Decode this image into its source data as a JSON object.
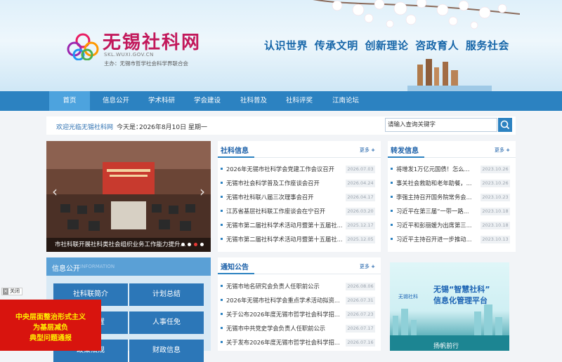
{
  "header": {
    "logo_title": "无锡社科网",
    "logo_url": "SKL.WUXI.GOV.CN",
    "logo_sub": "主办：无锡市哲学社会科学界联合会",
    "slogan": "认识世界 传承文明 创新理论 咨政育人 服务社会"
  },
  "nav": [
    "首页",
    "信息公开",
    "学术科研",
    "学会建设",
    "社科普及",
    "社科评奖",
    "江南论坛"
  ],
  "infobar": {
    "welcome": "欢迎光临无锡社科网",
    "today_label": "今天是：",
    "date": "2026年8月10日 星期一",
    "search_placeholder": "请输入查询关键字"
  },
  "slide": {
    "caption": "市社科联开展社科类社会组织业务工作能力提升..."
  },
  "sk_news": {
    "title": "社科信息",
    "more": "更多",
    "items": [
      {
        "title": "2026年无锡市社科学会党建工作会议召开",
        "date": "2026.07.03"
      },
      {
        "title": "无锡市社会科学普及工作座谈会召开",
        "date": "2026.04.24"
      },
      {
        "title": "无锡市社科联八届三次理事会召开",
        "date": "2026.04.17"
      },
      {
        "title": "江苏省基层社科联工作座谈会在宁召开",
        "date": "2026.03.20"
      },
      {
        "title": "无锡市第二届社科学术活动月暨第十五届社...",
        "date": "2025.12.17"
      },
      {
        "title": "无锡市第二届社科学术活动月暨第十五届社...",
        "date": "2025.12.05"
      }
    ]
  },
  "zf_news": {
    "title": "转发信息",
    "more": "更多",
    "items": [
      {
        "title": "将增发1万亿元国债！怎么...",
        "date": "2023.10.26"
      },
      {
        "title": "事关社会救助和老年助餐，...",
        "date": "2023.10.26"
      },
      {
        "title": "李强主持召开国务院常务会...",
        "date": "2023.10.23"
      },
      {
        "title": "习近平在第三届“一带一路...",
        "date": "2023.10.18"
      },
      {
        "title": "习近平和彭丽媛为出席第三...",
        "date": "2023.10.18"
      },
      {
        "title": "习近平主持召开进一步推动...",
        "date": "2023.10.13"
      }
    ]
  },
  "notice": {
    "title": "通知公告",
    "more": "更多",
    "items": [
      {
        "title": "无锡市地名研究会负责人任职前公示",
        "date": "2026.08.06"
      },
      {
        "title": "2026年无锡市社科学会重点学术活动拟资...",
        "date": "2026.07.31"
      },
      {
        "title": "关于公布2026年度无锡市哲学社会科学招...",
        "date": "2026.07.23"
      },
      {
        "title": "无锡市中共党史学会负责人任职前公示",
        "date": "2026.07.17"
      },
      {
        "title": "关于发布2026年度无锡市哲学社会科学招...",
        "date": "2026.07.16"
      }
    ]
  },
  "info_panel": {
    "title": "信息公开",
    "title_en": "INFORMATION",
    "buttons": [
      "社科联简介",
      "计划总结",
      "机构设置",
      "人事任免",
      "政策法规",
      "财政信息"
    ]
  },
  "banner": {
    "line1": "无锡“智慧社科”",
    "line2": "信息化管理平台",
    "logo": "无锡社科",
    "bottom": "扬帆前行"
  },
  "float_ad": {
    "close": "关闭",
    "lines": [
      "中央层面整治形式主义",
      "为基层减负",
      "典型问题通报"
    ]
  },
  "colors": {
    "nav": "#2c82c1",
    "accent": "#1a5fa8",
    "ad_bg": "#d8140e",
    "ad_text": "#fff200"
  }
}
